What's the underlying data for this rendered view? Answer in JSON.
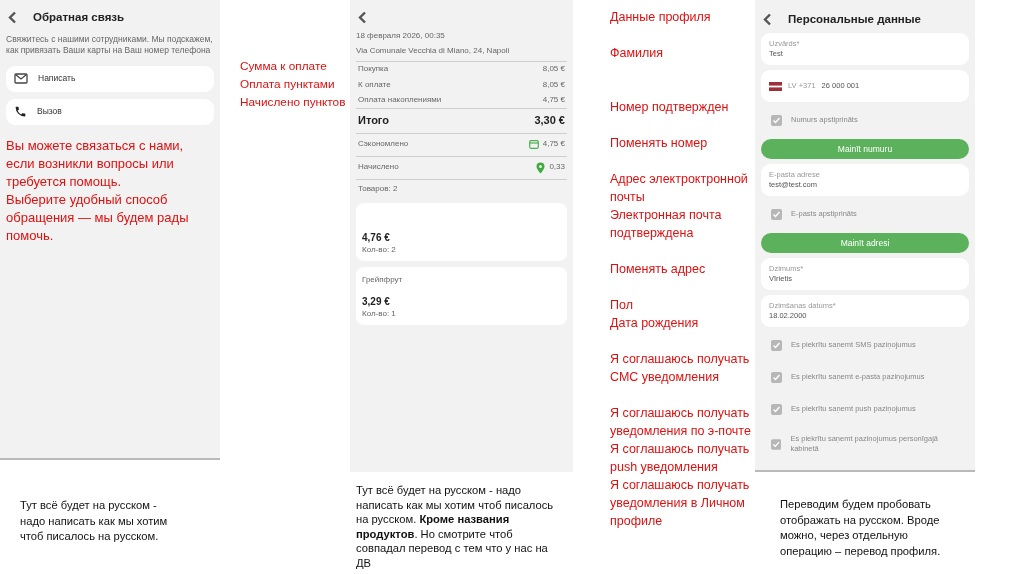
{
  "feedback_screen": {
    "title": "Обратная связь",
    "description": "Свяжитесь с нашими сотрудниками. Мы подскажем, как привязать Ваши карты на Ваш номер телефона",
    "actions": [
      {
        "kind": "mail",
        "label": "Написать"
      },
      {
        "kind": "phone",
        "label": "Вызов"
      }
    ],
    "note": [
      "Вы можете связаться с нами, если возникли вопросы или требуется помощь.",
      "Выберите удобный способ обращения — мы будем рады помочь."
    ]
  },
  "receipt_annotations": [
    "Сумма к оплате",
    "Оплата пунктами",
    "Начислено пунктов"
  ],
  "receipt_screen": {
    "date": "18 февраля 2026, 00:35",
    "address": "Via Comunale Vecchia di Miano, 24, Napoli",
    "rows": [
      {
        "kind": "plain",
        "label": "Покупка",
        "value": "8,05 €"
      },
      {
        "kind": "plain",
        "label": "К оплате",
        "value": "8,05 €"
      },
      {
        "kind": "plain",
        "label": "Оплата накоплениями",
        "value": "4,75 €"
      },
      {
        "kind": "total",
        "label": "Итого",
        "value": "3,30 €"
      },
      {
        "kind": "saved",
        "label": "Сэкономлено",
        "value": "4,75 €"
      },
      {
        "kind": "points",
        "label": "Начислено",
        "value": "0,33"
      }
    ],
    "items_count": "Товаров: 2",
    "items": [
      {
        "price": "4,76 €",
        "quantity": "Кол-во: 2"
      },
      {
        "name": "Грейпфрут",
        "price": "3,29 €",
        "quantity": "Кол-во: 1"
      }
    ]
  },
  "profile_annotations": [
    "Данные профиля",
    "Фамилия",
    "Номер подтвержден",
    "Поменять номер",
    "Адрес электроктронной почты",
    "Электронная почта подтверждена",
    "Поменять адрес",
    "Пол",
    "Дата рождения",
    "Я соглашаюсь получать СМС уведомления",
    "Я соглашаюсь получать уведомления по э-почте",
    "Я соглашаюсь получать push уведомления",
    "Я соглашаюсь получать уведомления в Личном профиле"
  ],
  "profile_screen": {
    "title": "Персональные данные",
    "fields": [
      {
        "kind": "text",
        "label": "Uzvārds*",
        "value": "Test"
      },
      {
        "kind": "phone",
        "country": "LV +371",
        "value": "26 000 001"
      },
      {
        "kind": "checkbox",
        "label": "Numurs apstiprināts",
        "checked": true
      },
      {
        "kind": "button",
        "label": "Mainīt numuru"
      },
      {
        "kind": "text",
        "label": "E-pasta adrese",
        "value": "test@test.com"
      },
      {
        "kind": "checkbox",
        "label": "E-pasts apstiprināts",
        "checked": true
      },
      {
        "kind": "button",
        "label": "Mainīt adresi"
      },
      {
        "kind": "text",
        "label": "Dzimums*",
        "value": "Vīrietis"
      },
      {
        "kind": "text",
        "label": "Dzimšanas datums*",
        "value": "18.02.2000"
      },
      {
        "kind": "checkbox",
        "label": "Es piekrītu saņemt SMS paziņojumus",
        "checked": true
      },
      {
        "kind": "checkbox",
        "label": "Es piekrītu saņemt e-pasta paziņojumus",
        "checked": true
      },
      {
        "kind": "checkbox",
        "label": "Es piekrītu saņemt push paziņojumus",
        "checked": true
      },
      {
        "kind": "checkbox",
        "label": "Es piekrītu saņemt paziņojumus personīgajā kabinetā",
        "checked": true
      }
    ]
  },
  "notes": [
    "Тут всё будет на русском - надо написать как мы хотим чтоб писалось на русском.",
    "Тут всё будет на русском - надо написать как мы хотим чтоб писалось на русском. **Кроме названия продуктов**. Но смотрите чтоб совпадал перевод с тем что у нас на ДВ",
    "Переводим будем пробовать отображать на русском. Вроде можно, через отдельную операцию – перевод профиля."
  ]
}
